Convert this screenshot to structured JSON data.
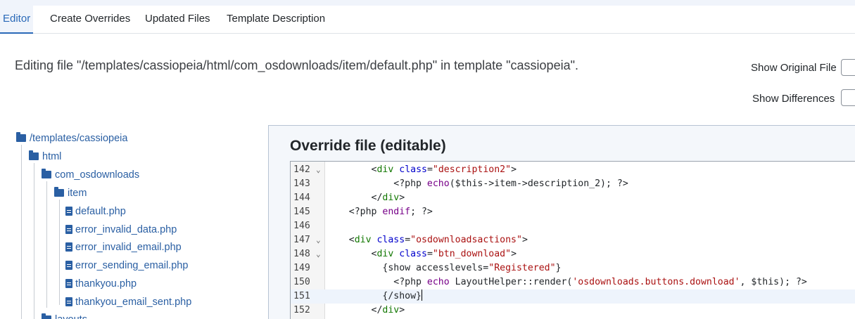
{
  "tabs": [
    {
      "label": "Editor",
      "active": true
    },
    {
      "label": "Create Overrides"
    },
    {
      "label": "Updated Files"
    },
    {
      "label": "Template Description"
    }
  ],
  "editing_info": "Editing file \"/templates/cassiopeia/html/com_osdownloads/item/default.php\" in template \"cassiopeia\".",
  "options": {
    "show_original": "Show Original File",
    "show_differences": "Show Differences"
  },
  "tree": {
    "root": "/templates/cassiopeia",
    "html": "html",
    "com": "com_osdownloads",
    "item": "item",
    "files": [
      "default.php",
      "error_invalid_data.php",
      "error_invalid_email.php",
      "error_sending_email.php",
      "thankyou.php",
      "thankyou_email_sent.php"
    ],
    "layouts": "layouts"
  },
  "panel": {
    "title": "Override file (editable)"
  },
  "code": {
    "active_line": 151,
    "colors": {
      "keyword": "#770088",
      "string": "#aa1111",
      "tag": "#117700",
      "attr": "#0000cc"
    },
    "lines": [
      {
        "num": "142",
        "fold": true,
        "text": "        <div class=\"description2\">"
      },
      {
        "num": "143",
        "fold": false,
        "text": "            <?php echo($this->item->description_2); ?>"
      },
      {
        "num": "144",
        "fold": false,
        "text": "        </div>"
      },
      {
        "num": "145",
        "fold": false,
        "text": "    <?php endif; ?>"
      },
      {
        "num": "146",
        "fold": false,
        "text": ""
      },
      {
        "num": "147",
        "fold": true,
        "text": "    <div class=\"osdownloadsactions\">"
      },
      {
        "num": "148",
        "fold": true,
        "text": "        <div class=\"btn_download\">"
      },
      {
        "num": "149",
        "fold": false,
        "text": "          {show accesslevels=\"Registered\"}"
      },
      {
        "num": "150",
        "fold": false,
        "text": "            <?php echo LayoutHelper::render('osdownloads.buttons.download', $this); ?>"
      },
      {
        "num": "151",
        "fold": false,
        "text": "          {/show}"
      },
      {
        "num": "152",
        "fold": false,
        "text": "        </div>"
      }
    ]
  }
}
